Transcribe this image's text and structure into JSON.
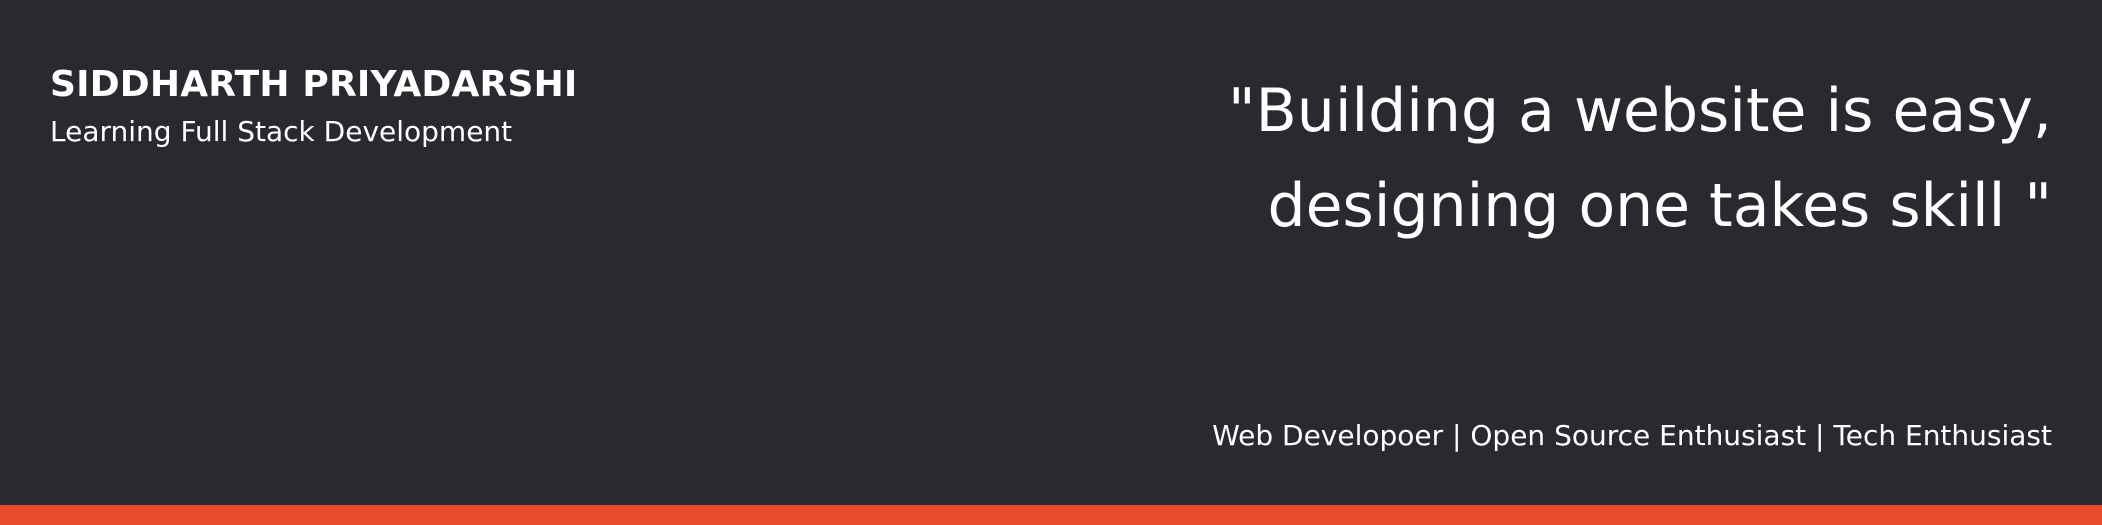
{
  "header": {
    "name": "SIDDHARTH PRIYADARSHI",
    "tagline": "Learning Full Stack Development"
  },
  "hero": {
    "quote_lines": [
      "\"Building a website is easy,",
      "designing one takes skill \""
    ],
    "roles": "Web Developoer | Open Source Enthusiast | Tech Enthusiast"
  },
  "colors": {
    "background": "#282a2f",
    "text": "#ffffff",
    "accent": "#e84a2a"
  }
}
